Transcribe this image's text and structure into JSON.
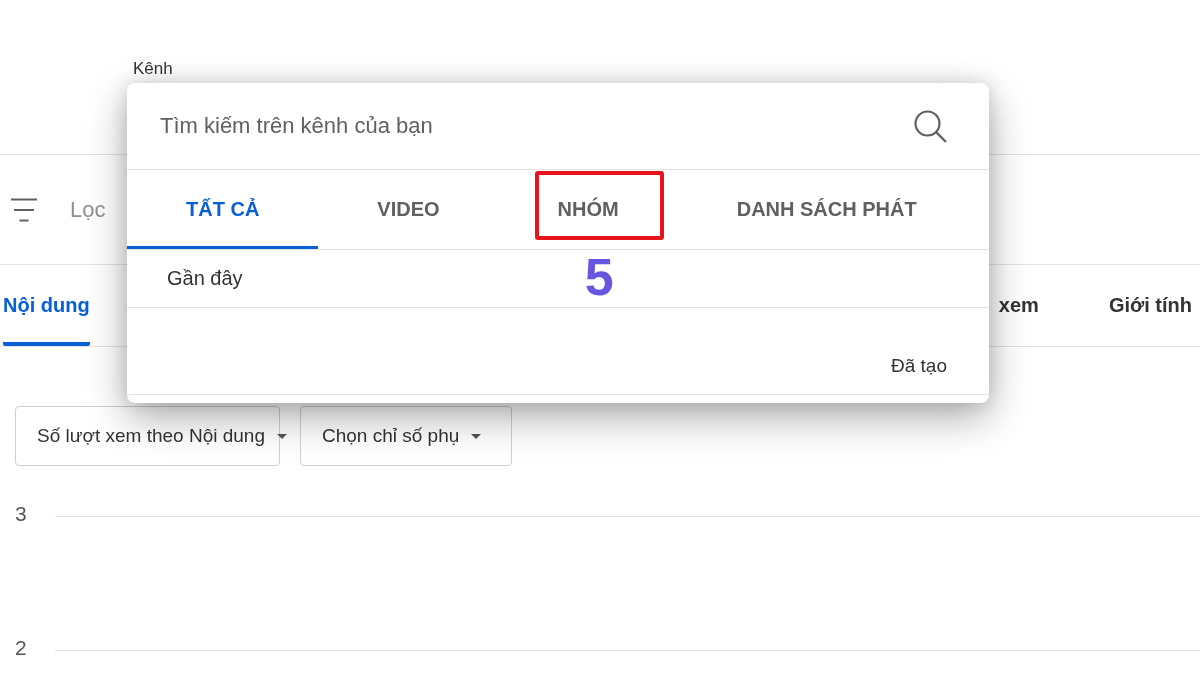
{
  "page": {
    "channel_label": "Kênh",
    "filter": {
      "placeholder": "Lọc"
    },
    "tabs": [
      {
        "label": "Nội dung",
        "selected": true
      },
      {
        "label": "xem",
        "selected": false
      },
      {
        "label": "Giới tính",
        "selected": false
      }
    ],
    "dropdowns": [
      {
        "value": "Số lượt xem theo Nội dung"
      },
      {
        "value": "Chọn chỉ số phụ"
      }
    ],
    "chart": {
      "gridline_labels": [
        "3",
        "2"
      ]
    }
  },
  "search_popup": {
    "search": {
      "placeholder": "Tìm kiếm trên kênh của bạn"
    },
    "tabs": [
      {
        "label": "TẤT CẢ",
        "selected": true,
        "highlighted": false
      },
      {
        "label": "VIDEO",
        "selected": false,
        "highlighted": false
      },
      {
        "label": "NHÓM",
        "selected": false,
        "highlighted": true
      },
      {
        "label": "DANH SÁCH PHÁT",
        "selected": false,
        "highlighted": false
      }
    ],
    "recent_heading": "Gần đây",
    "created_column": "Đã tạo"
  },
  "annotation": {
    "label": "5"
  }
}
